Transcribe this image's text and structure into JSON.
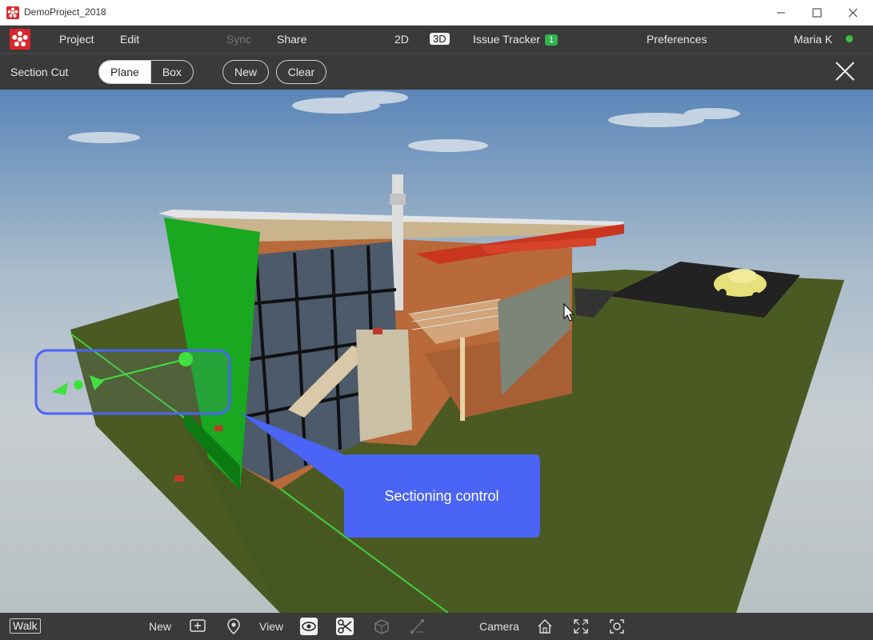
{
  "window": {
    "title": "DemoProject_2018"
  },
  "menu": {
    "project": "Project",
    "edit": "Edit",
    "sync": "Sync",
    "share": "Share",
    "view_2d": "2D",
    "view_3d": "3D",
    "issue_tracker": "Issue Tracker",
    "issue_count": "1",
    "preferences": "Preferences",
    "user": "Maria K"
  },
  "toolbar": {
    "label": "Section Cut",
    "plane": "Plane",
    "box": "Box",
    "new": "New",
    "clear": "Clear"
  },
  "callout": {
    "text": "Sectioning control"
  },
  "bottombar": {
    "walk": "Walk",
    "new": "New",
    "view": "View",
    "camera": "Camera"
  },
  "colors": {
    "brand": "#d9262a",
    "callout": "#4a64f5",
    "section_plane": "#22b022",
    "status_online": "#3fbf4a",
    "issue_badge": "#33b34a"
  }
}
